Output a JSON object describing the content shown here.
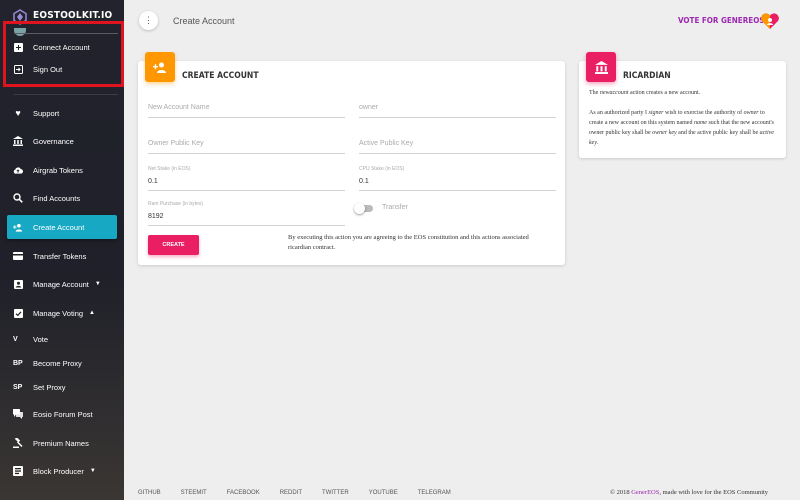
{
  "sidebar": {
    "brand": "EOSTOOLKIT.IO",
    "top_items": [
      {
        "label": "Connect Account",
        "icon": "plus-box-icon"
      },
      {
        "label": "Sign Out",
        "icon": "sign-out-icon"
      }
    ],
    "items": [
      {
        "label": "Support",
        "icon": "heart-icon"
      },
      {
        "label": "Governance",
        "icon": "bank-icon"
      },
      {
        "label": "Airgrab Tokens",
        "icon": "cloud-upload-icon"
      },
      {
        "label": "Find Accounts",
        "icon": "search-icon"
      },
      {
        "label": "Create Account",
        "icon": "person-add-icon",
        "active": true
      },
      {
        "label": "Transfer Tokens",
        "icon": "card-icon"
      },
      {
        "label": "Manage Account",
        "icon": "account-box-icon",
        "caret": "▼"
      },
      {
        "label": "Manage Voting",
        "icon": "checkbox-icon",
        "caret": "▲"
      },
      {
        "label": "Vote",
        "abbr": "V"
      },
      {
        "label": "Become Proxy",
        "abbr": "BP"
      },
      {
        "label": "Set Proxy",
        "abbr": "SP"
      },
      {
        "label": "Eosio Forum Post",
        "icon": "forum-icon"
      },
      {
        "label": "Premium Names",
        "icon": "gavel-icon"
      },
      {
        "label": "Block Producer",
        "icon": "server-icon",
        "caret": "▼"
      }
    ]
  },
  "header": {
    "menu_icon": "⋮",
    "title": "Create Account",
    "vote_text": "VOTE FOR GENEREOS"
  },
  "create_card": {
    "title": "CREATE ACCOUNT",
    "new_account_name_placeholder": "New Account Name",
    "owner_placeholder": "owner",
    "owner_public_key_placeholder": "Owner Public Key",
    "active_public_key_placeholder": "Active Public Key",
    "net_stake_label": "Net Stake (in EOS)",
    "net_stake_value": "0.1",
    "cpu_stake_label": "CPU Stake (in EOS)",
    "cpu_stake_value": "0.1",
    "ram_purchase_label": "Ram Purchase (in bytes)",
    "ram_purchase_value": "8192",
    "transfer_label": "Transfer",
    "transfer_on": false,
    "create_button": "CREATE",
    "agreement": "By executing this action you are agreeing to the EOS constitution and this actions associated ricardian contract."
  },
  "ricardian_card": {
    "title": "RICARDIAN",
    "p1_a": "The ",
    "p1_em": "newaccount",
    "p1_b": " action creates a new account.",
    "p2_a": "As an authorized party I ",
    "p2_em1": "signer",
    "p2_b": " wish to exercise the authority of ",
    "p2_em2": "owner",
    "p2_c": " to create a new account on this system named ",
    "p2_em3": "name",
    "p2_d": " such that the new account's owner public key shall be ",
    "p2_em4": "owner key",
    "p2_e": " and the active public key shall be ",
    "p2_em5": "active key",
    "p2_f": "."
  },
  "footer": {
    "links": [
      "GITHUB",
      "STEEMIT",
      "FACEBOOK",
      "REDDIT",
      "TWITTER",
      "YOUTUBE",
      "TELEGRAM"
    ],
    "copyright_a": "© 2018 ",
    "copyright_brand": "GenerEOS",
    "copyright_b": ", made with love for the EOS Community"
  },
  "colors": {
    "accent_cyan": "#17a8c3",
    "orange": "#ff9800",
    "pink": "#e91e63",
    "purple": "#9c27b0",
    "highlight_red": "#e0141e"
  }
}
